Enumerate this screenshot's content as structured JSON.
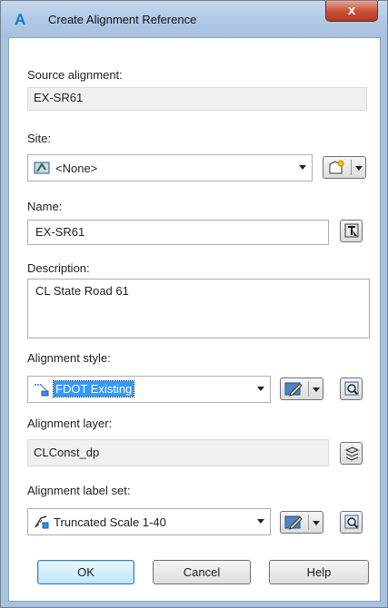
{
  "window": {
    "title": "Create Alignment Reference",
    "close_label": "x"
  },
  "source": {
    "label": "Source alignment:",
    "value": "EX-SR61"
  },
  "site": {
    "label": "Site:",
    "value": "<None>"
  },
  "name": {
    "label": "Name:",
    "value": "EX-SR61"
  },
  "description": {
    "label": "Description:",
    "value": "CL State Road 61"
  },
  "style": {
    "label": "Alignment style:",
    "value": "FDOT Existing"
  },
  "layer": {
    "label": "Alignment layer:",
    "value": "CLConst_dp"
  },
  "label_set": {
    "label": "Alignment label set:",
    "value": "Truncated Scale 1-40"
  },
  "buttons": {
    "ok": "OK",
    "cancel": "Cancel",
    "help": "Help"
  },
  "colors": {
    "accent": "#3399ff",
    "title_bg": "#b3cbe7",
    "close_red": "#c9523b"
  },
  "icons": {
    "app": "autocad-civil-icon",
    "site_combo": "site-icon",
    "create_site": "new-site-icon",
    "pick_name": "pick-from-drawing-icon",
    "edit": "edit-style-icon",
    "detail": "detail-view-icon",
    "layer": "layer-icon",
    "style_combo": "alignment-style-icon",
    "label_set_combo": "label-set-icon"
  }
}
